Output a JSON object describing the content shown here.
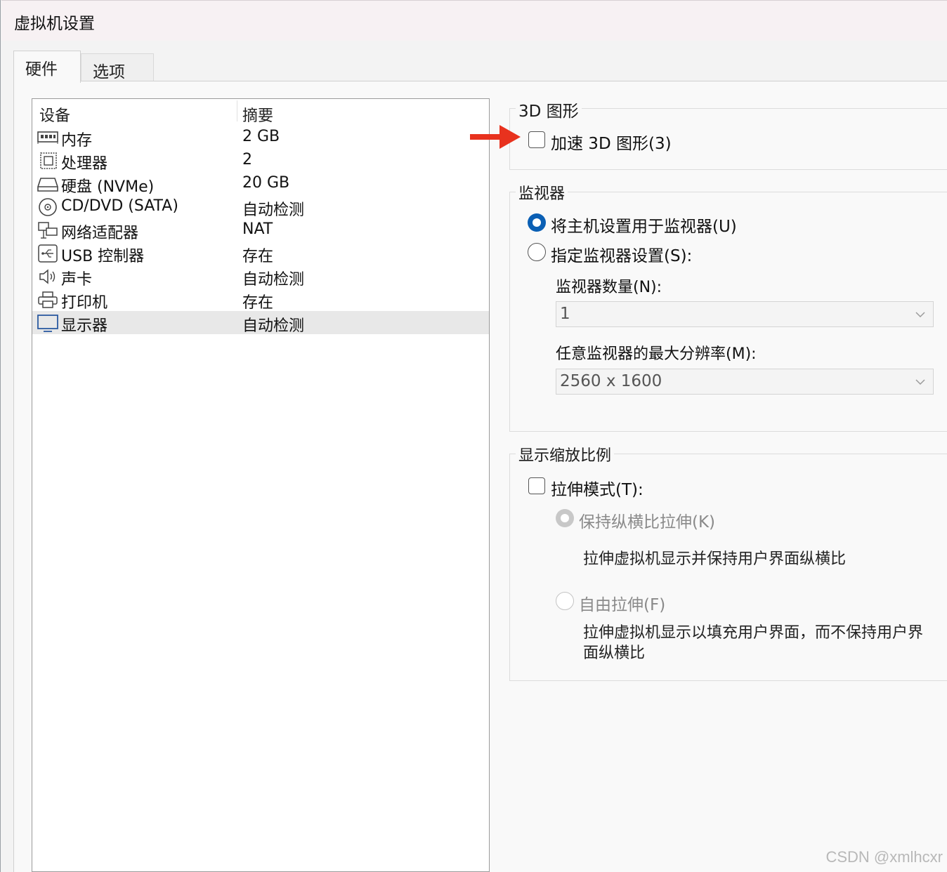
{
  "window": {
    "title": "虚拟机设置"
  },
  "tabs": [
    {
      "label": "硬件",
      "active": true
    },
    {
      "label": "选项",
      "active": false
    }
  ],
  "device_list": {
    "columns": [
      "设备",
      "摘要"
    ],
    "rows": [
      {
        "icon": "memory-icon",
        "name": "内存",
        "summary": "2 GB"
      },
      {
        "icon": "processor-icon",
        "name": "处理器",
        "summary": "2"
      },
      {
        "icon": "hard-disk-icon",
        "name": "硬盘 (NVMe)",
        "summary": "20 GB"
      },
      {
        "icon": "cd-dvd-icon",
        "name": "CD/DVD (SATA)",
        "summary": "自动检测"
      },
      {
        "icon": "network-adapter-icon",
        "name": "网络适配器",
        "summary": "NAT"
      },
      {
        "icon": "usb-controller-icon",
        "name": "USB 控制器",
        "summary": "存在"
      },
      {
        "icon": "sound-card-icon",
        "name": "声卡",
        "summary": "自动检测"
      },
      {
        "icon": "printer-icon",
        "name": "打印机",
        "summary": "存在"
      },
      {
        "icon": "display-icon",
        "name": "显示器",
        "summary": "自动检测",
        "selected": true
      }
    ]
  },
  "graphics_3d": {
    "title": "3D 图形",
    "accelerate_label": "加速 3D 图形(3)",
    "accelerate_checked": false
  },
  "monitor": {
    "title": "监视器",
    "use_host_label": "将主机设置用于监视器(U)",
    "specify_label": "指定监视器设置(S):",
    "selected": "use_host",
    "count_label": "监视器数量(N):",
    "count_value": "1",
    "max_res_label": "任意监视器的最大分辨率(M):",
    "max_res_value": "2560 x 1600"
  },
  "scaling": {
    "title": "显示缩放比例",
    "stretch_label": "拉伸模式(T):",
    "stretch_checked": false,
    "keep_aspect_label": "保持纵横比拉伸(K)",
    "keep_aspect_desc": "拉伸虚拟机显示并保持用户界面纵横比",
    "free_label": "自由拉伸(F)",
    "free_desc": "拉伸虚拟机显示以填充用户界面，而不保持用户界面纵横比"
  },
  "watermark": "CSDN @xmlhcxr",
  "colors": {
    "accent": "#0a5fb4",
    "annotation_arrow": "#e8321e"
  }
}
